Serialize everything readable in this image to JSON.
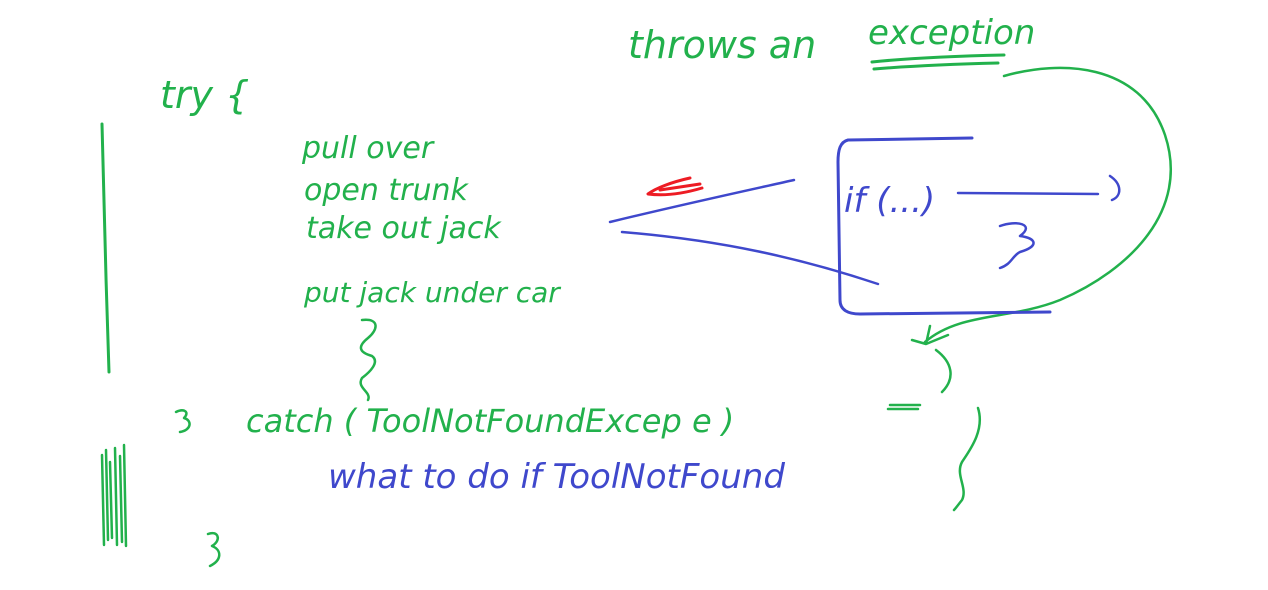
{
  "colors": {
    "background": "#ffffff",
    "green_ink": "#22b14c",
    "blue_ink": "#3f48cc",
    "red_ink": "#ed1c24"
  },
  "notes": {
    "throws_label": "throws an",
    "exception_label": "exception",
    "try_label": "try {",
    "step_pull_over": "pull over",
    "step_open_trunk": "open trunk",
    "step_take_out_jack": "take out jack",
    "step_put_jack": "put jack under car",
    "catch_label": "catch ( ToolNotFoundExcep e )",
    "what_to_do": "what to do if ToolNotFound",
    "if_block_label": "if (...)"
  }
}
